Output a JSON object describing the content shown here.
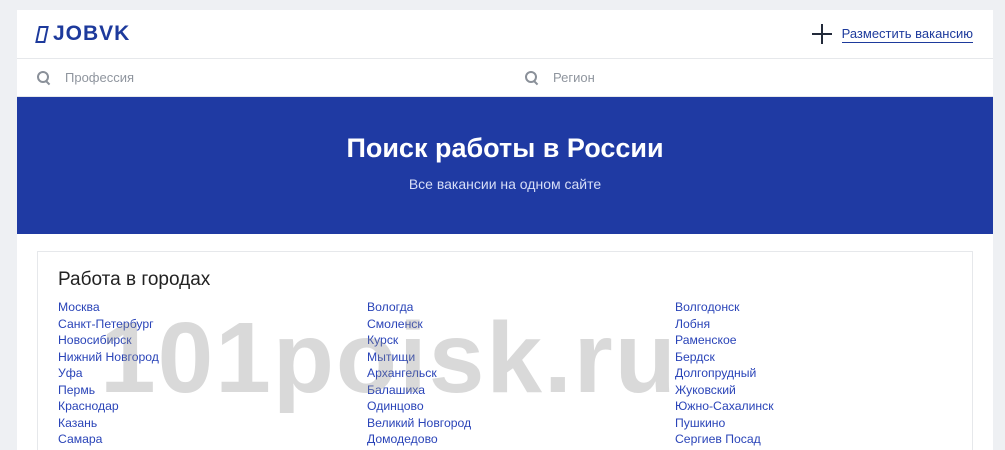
{
  "header": {
    "logo_text": "JOBVK",
    "post_job_label": "Разместить вакансию"
  },
  "search": {
    "profession_placeholder": "Профессия",
    "region_placeholder": "Регион"
  },
  "hero": {
    "title": "Поиск работы в России",
    "subtitle": "Все вакансии на одном сайте"
  },
  "cities": {
    "title": "Работа в городах",
    "col1": [
      "Москва",
      "Санкт-Петербург",
      "Новосибирск",
      "Нижний Новгород",
      "Уфа",
      "Пермь",
      "Краснодар",
      "Казань",
      "Самара"
    ],
    "col2": [
      "Вологда",
      "Смоленск",
      "Курск",
      "Мытищи",
      "Архангельск",
      "Балашиха",
      "Одинцово",
      "Великий Новгород",
      "Домодедово"
    ],
    "col3": [
      "Волгодонск",
      "Лобня",
      "Раменское",
      "Бердск",
      "Долгопрудный",
      "Жуковский",
      "Южно-Сахалинск",
      "Пушкино",
      "Сергиев Посад"
    ]
  },
  "watermark": "101poisk.ru",
  "colors": {
    "brand": "#1d3a9c",
    "hero_bg": "#1f3aa3",
    "link": "#2a44b8"
  }
}
